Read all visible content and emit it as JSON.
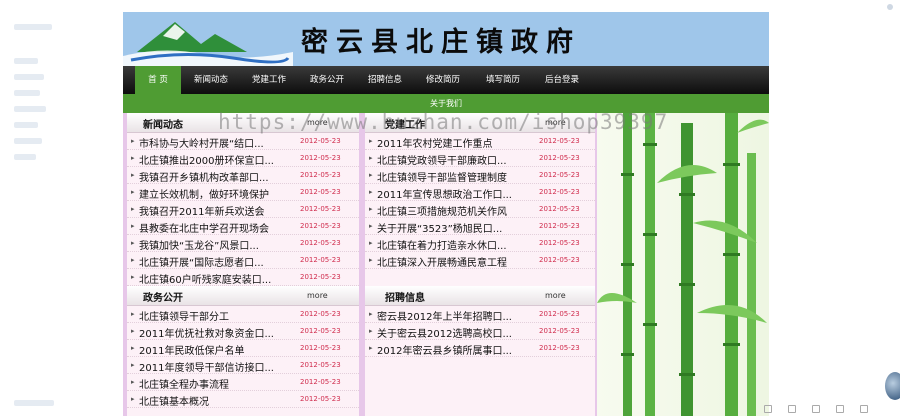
{
  "site": {
    "title": "密云县北庄镇政府"
  },
  "nav": {
    "items": [
      "首 页",
      "新闻动态",
      "党建工作",
      "政务公开",
      "招聘信息",
      "修改简历",
      "填写简历",
      "后台登录"
    ],
    "active_index": 0,
    "sub_item": "关于我们"
  },
  "watermark": "https://www.huzhan.com/ishop39397",
  "sections": {
    "news": {
      "title": "新闻动态",
      "more": "more",
      "items": [
        {
          "text": "市科协与大岭村开展“结口...",
          "date": "2012-05-23"
        },
        {
          "text": "北庄镇推出2000册环保宣口...",
          "date": "2012-05-23"
        },
        {
          "text": "我镇召开乡镇机构改革部口...",
          "date": "2012-05-23"
        },
        {
          "text": "建立长效机制，做好环境保护",
          "date": "2012-05-23"
        },
        {
          "text": "我镇召开2011年新兵欢送会",
          "date": "2012-05-23"
        },
        {
          "text": "县教委在北庄中学召开现场会",
          "date": "2012-05-23"
        },
        {
          "text": "我镇加快“玉龙谷”风景口...",
          "date": "2012-05-23"
        },
        {
          "text": "北庄镇开展“国际志愿者口...",
          "date": "2012-05-23"
        },
        {
          "text": "北庄镇60户听残家庭安装口...",
          "date": "2012-05-23"
        }
      ]
    },
    "party": {
      "title": "党建工作",
      "more": "more",
      "items": [
        {
          "text": "2011年农村党建工作重点",
          "date": "2012-05-23"
        },
        {
          "text": "北庄镇党政领导干部廉政口...",
          "date": "2012-05-23"
        },
        {
          "text": "北庄镇领导干部监督管理制度",
          "date": "2012-05-23"
        },
        {
          "text": "2011年宣传思想政治工作口...",
          "date": "2012-05-23"
        },
        {
          "text": "北庄镇三项措施规范机关作风",
          "date": "2012-05-23"
        },
        {
          "text": "关于开展“3523”杨旭民口...",
          "date": "2012-05-23"
        },
        {
          "text": "北庄镇在着力打造亲水休口...",
          "date": "2012-05-23"
        },
        {
          "text": "北庄镇深入开展畅通民意工程",
          "date": "2012-05-23"
        }
      ]
    },
    "affairs": {
      "title": "政务公开",
      "more": "more",
      "items": [
        {
          "text": "北庄镇领导干部分工",
          "date": "2012-05-23"
        },
        {
          "text": "2011年优抚社救对象资金口...",
          "date": "2012-05-23"
        },
        {
          "text": "2011年民政低保户名单",
          "date": "2012-05-23"
        },
        {
          "text": "2011年度领导干部信访接口...",
          "date": "2012-05-23"
        },
        {
          "text": "北庄镇全程办事流程",
          "date": "2012-05-23"
        },
        {
          "text": "北庄镇基本概况",
          "date": "2012-05-23"
        }
      ]
    },
    "jobs": {
      "title": "招聘信息",
      "more": "more",
      "items": [
        {
          "text": "密云县2012年上半年招聘口...",
          "date": "2012-05-23"
        },
        {
          "text": "关于密云县2012选聘高校口...",
          "date": "2012-05-23"
        },
        {
          "text": "2012年密云县乡镇所属事口...",
          "date": "2012-05-23"
        }
      ]
    }
  },
  "colors": {
    "banner": "#9fc6ea",
    "nav_bar": "#1a1a1a",
    "accent_green": "#4f9c33",
    "date_red": "#d02c4d",
    "column_bg": "#fdf1f7"
  },
  "icons": [
    "mountain-logo-icon",
    "bamboo-image",
    "globe-icon",
    "bullet-icon"
  ]
}
